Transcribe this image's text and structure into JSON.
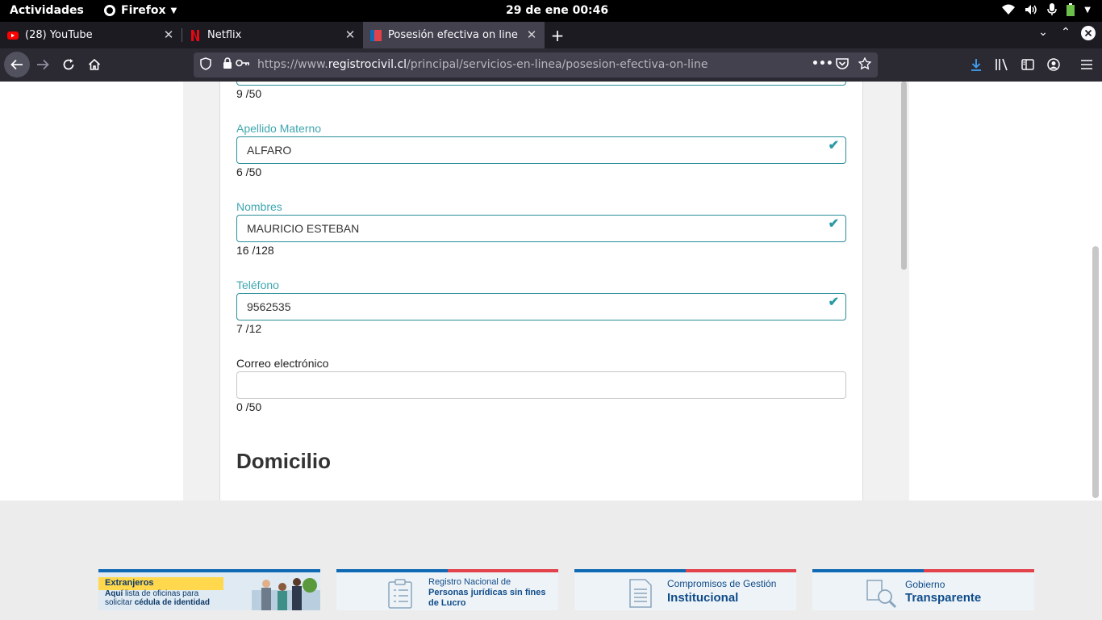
{
  "system_bar": {
    "activities": "Actividades",
    "app_name": "Firefox",
    "clock": "29 de ene  00:46"
  },
  "tabs": [
    {
      "label": "(28) YouTube",
      "icon": "youtube-icon",
      "active": false
    },
    {
      "label": "Netflix",
      "icon": "netflix-icon",
      "active": false
    },
    {
      "label": "Posesión efectiva on line",
      "icon": "flag-icon",
      "active": true
    }
  ],
  "address_bar": {
    "prefix": "https://www.",
    "host": "registrocivil.cl",
    "path": "/principal/servicios-en-linea/posesion-efectiva-on-line"
  },
  "form": {
    "prev_counter": "9 /50",
    "fields": [
      {
        "label": "Apellido Materno",
        "value": "ALFARO",
        "counter": "6 /50",
        "valid": true
      },
      {
        "label": "Nombres",
        "value": "MAURICIO ESTEBAN",
        "counter": "16 /128",
        "valid": true
      },
      {
        "label": "Teléfono",
        "value": "9562535",
        "counter": "7 /12",
        "valid": true
      },
      {
        "label": "Correo electrónico",
        "value": "",
        "counter": "0 /50",
        "valid": false
      }
    ],
    "section_title": "Domicilio"
  },
  "footer": {
    "banners": [
      {
        "line1": "Extranjeros",
        "line2a": "Aquí",
        "line2b": " lista de oficinas para",
        "line3a": "solicitar ",
        "line3b": "cédula de identidad"
      },
      {
        "line1": "Registro Nacional de",
        "line2": "Personas jurídicas sin fines",
        "line3": "de Lucro"
      },
      {
        "line1": "Compromisos de Gestión",
        "line2": "Institucional"
      },
      {
        "line1": "Gobierno",
        "line2": "Transparente"
      }
    ]
  },
  "colors": {
    "accent_teal": "#2a8e9a",
    "gob_blue": "#0f69b4",
    "gob_red": "#e2434b"
  }
}
